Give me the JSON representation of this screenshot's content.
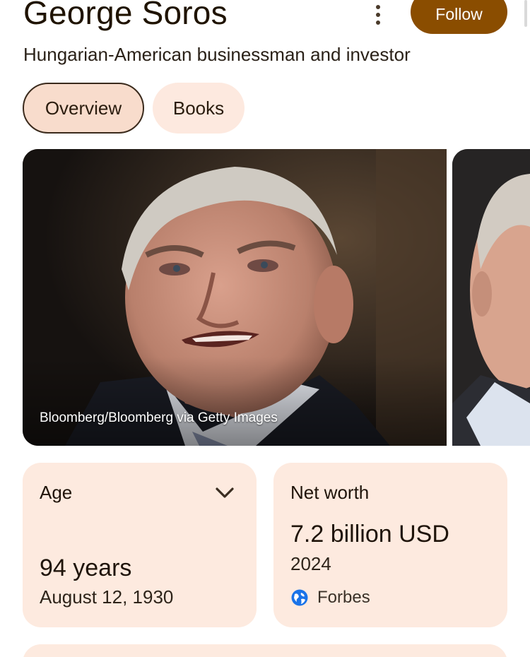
{
  "header": {
    "title": "George Soros",
    "subtitle": "Hungarian-American businessman and investor",
    "more_icon": "more-vert-icon",
    "follow_label": "Follow"
  },
  "tabs": [
    {
      "label": "Overview",
      "selected": true
    },
    {
      "label": "Books",
      "selected": false
    }
  ],
  "photos": {
    "main_credit": "Bloomberg/Bloomberg via Getty Images"
  },
  "cards": {
    "age": {
      "label": "Age",
      "value": "94 years",
      "detail": "August 12, 1930",
      "expand_icon": "chevron-down-icon"
    },
    "net_worth": {
      "label": "Net worth",
      "value": "7.2 billion USD",
      "detail": "2024",
      "source": "Forbes",
      "source_icon": "globe-icon"
    }
  },
  "colors": {
    "accent": "#8a4d00",
    "chip_selected": "#f8dccc",
    "card_bg": "#fdeadf"
  }
}
